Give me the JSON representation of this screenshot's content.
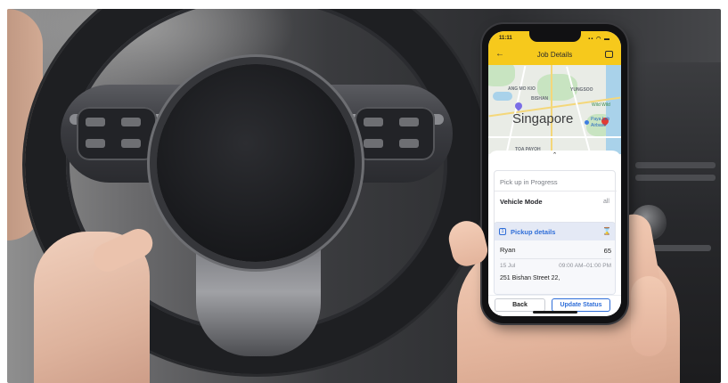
{
  "phone": {
    "status": {
      "time": "11:11",
      "icons": "▪▪ ◠ ▬"
    },
    "header": {
      "title": "Job Details",
      "back_icon": "back-arrow-icon",
      "chat_icon": "chat-icon"
    },
    "map": {
      "city": "Singapore",
      "labels": {
        "ang_mo_kio": "ANG MO KIO",
        "yungsoo": "YUNGSOO",
        "toa_payoh": "TOA PAYOH",
        "bishan": "BISHAN"
      },
      "pois": {
        "paya_lebar": "Paya Leb",
        "airbase": "Airbase",
        "wild": "Wild Wild"
      }
    },
    "sheet": {
      "progress_text": "Pick up in Progress",
      "vehicle_mode_label": "Vehicle Mode",
      "vehicle_mode_value": "all",
      "pickup": {
        "number": "1",
        "title": "Pickup details",
        "name": "Ryan",
        "count": "65",
        "date": "15 Jul",
        "time": "09:00 AM–01:00 PM",
        "address": "251 Bishan Street 22,"
      },
      "buttons": {
        "back": "Back",
        "update_status": "Update Status"
      }
    }
  },
  "colors": {
    "accent_yellow": "#f6c91c",
    "accent_blue": "#2f6ed8"
  }
}
